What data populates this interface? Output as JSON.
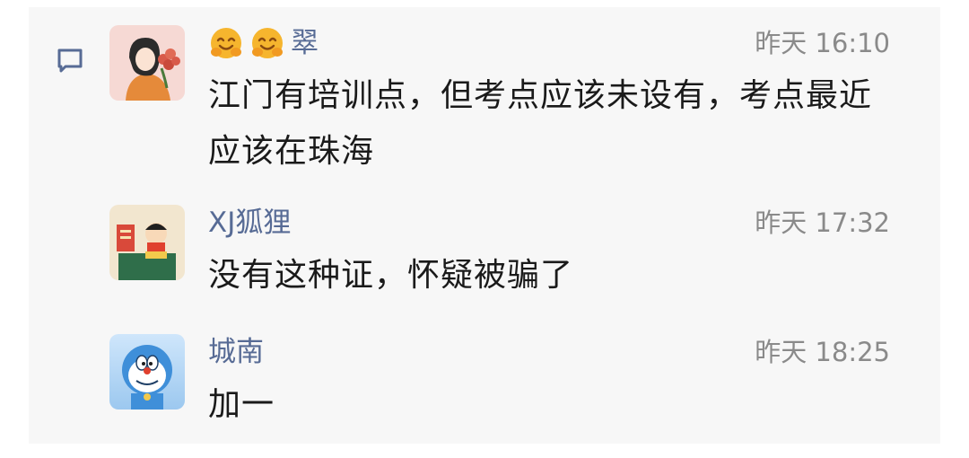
{
  "comments": [
    {
      "name": "翠",
      "name_emojis": [
        "smiling-hug-emoji",
        "smiling-hug-emoji"
      ],
      "time": "昨天 16:10",
      "text": "江门有培训点，但考点应该未设有，考点最近应该在珠海"
    },
    {
      "name": "XJ狐狸",
      "time": "昨天 17:32",
      "text": "没有这种证，怀疑被骗了"
    },
    {
      "name": "城南",
      "time": "昨天 18:25",
      "text": "加一"
    }
  ],
  "colors": {
    "name": "#576b95",
    "time": "#8a8a8a",
    "text": "#1a1a1a",
    "panel_bg": "#f7f7f7"
  },
  "icons": {
    "side": "comment-icon"
  }
}
